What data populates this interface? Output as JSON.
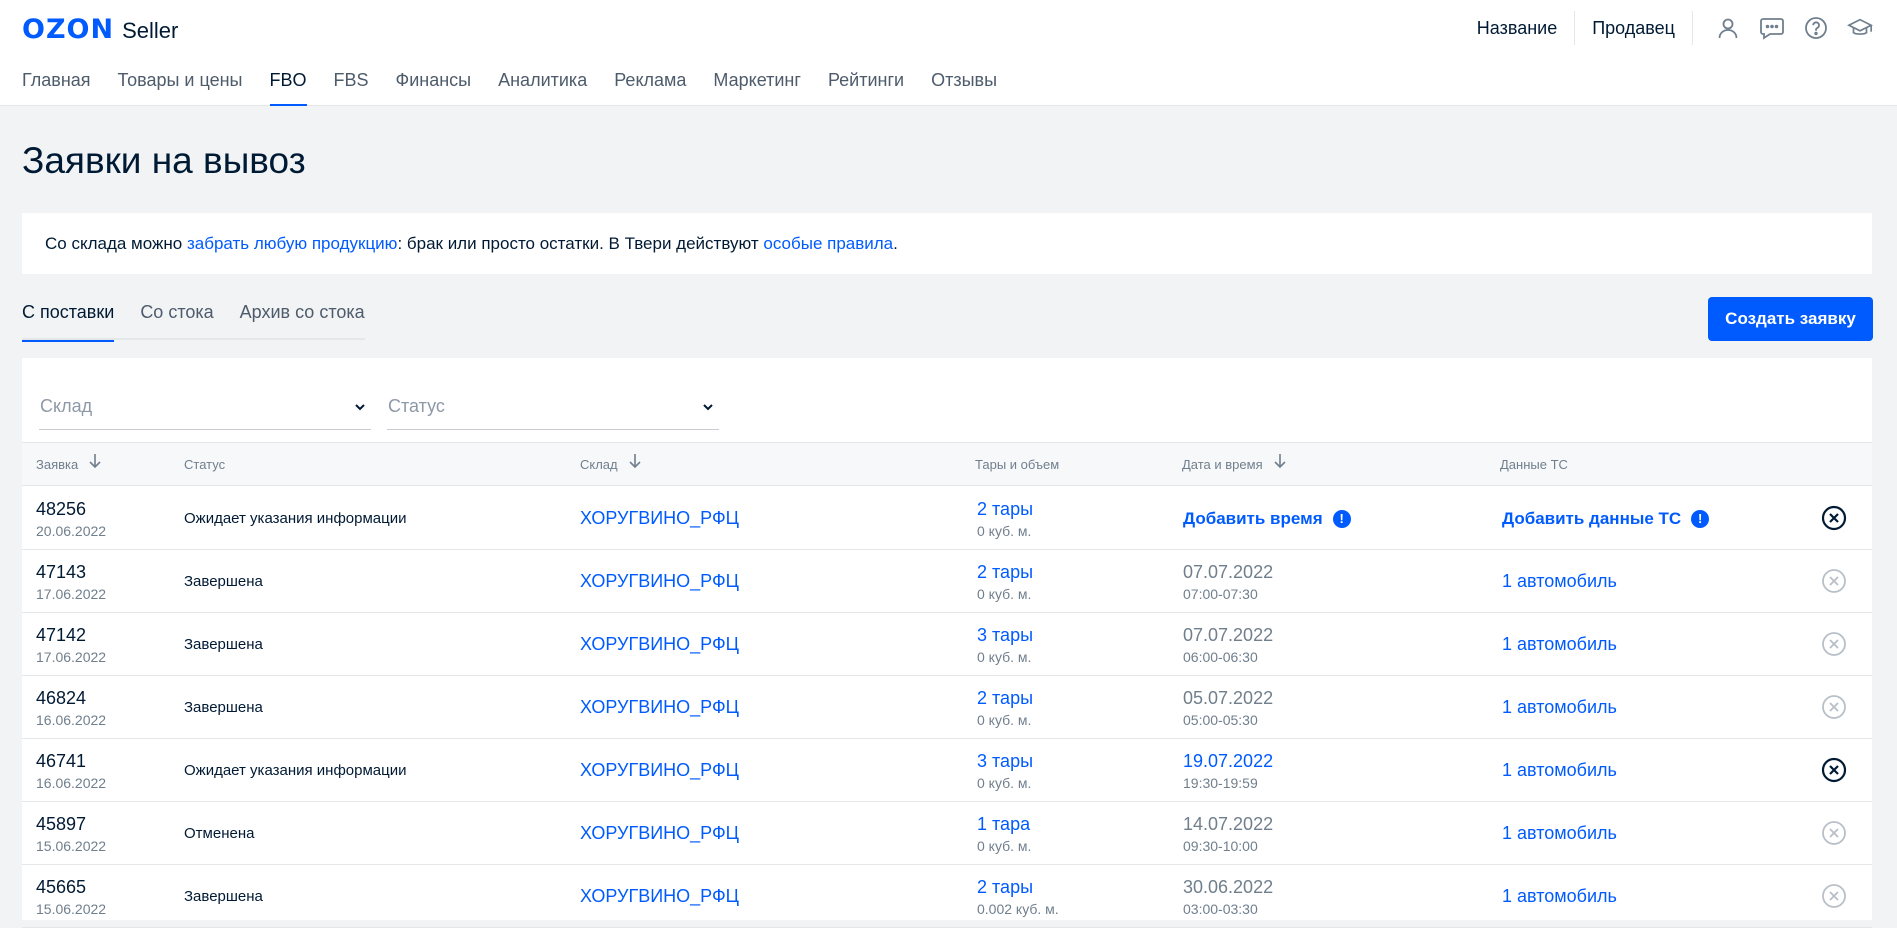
{
  "header": {
    "logo_brand": "OZON",
    "logo_product": "Seller",
    "top_links": [
      "Название",
      "Продавец"
    ],
    "icons": [
      "user-icon",
      "chat-icon",
      "help-icon",
      "education-icon"
    ],
    "nav": [
      "Главная",
      "Товары и цены",
      "FBO",
      "FBS",
      "Финансы",
      "Аналитика",
      "Реклама",
      "Маркетинг",
      "Рейтинги",
      "Отзывы"
    ],
    "nav_active": "FBO"
  },
  "page": {
    "title": "Заявки на вывоз",
    "notice": {
      "text1": "Со склада можно ",
      "link1": "забрать любую продукцию",
      "text2": ": брак или просто остатки. В Твери действуют ",
      "link2": "особые правила",
      "text3": "."
    },
    "tabs": [
      "С поставки",
      "Со стока",
      "Архив со стока"
    ],
    "active_tab": "С поставки",
    "create_button": "Создать заявку"
  },
  "filters": {
    "warehouse_placeholder": "Склад",
    "status_placeholder": "Статус"
  },
  "table": {
    "columns": [
      "Заявка",
      "Статус",
      "Склад",
      "Тары и объем",
      "Дата и время",
      "Данные ТС"
    ],
    "rows": [
      {
        "id": "48256",
        "date": "20.06.2022",
        "status": "Ожидает указания информации",
        "warehouse": "ХОРУГВИНО_РФЦ",
        "tares": "2 тары",
        "volume": "0 куб. м.",
        "time_action": "Добавить время",
        "vehicle_action": "Добавить данные ТС",
        "cancelable": true
      },
      {
        "id": "47143",
        "date": "17.06.2022",
        "status": "Завершена",
        "warehouse": "ХОРУГВИНО_РФЦ",
        "tares": "2 тары",
        "volume": "0 куб. м.",
        "slot_date": "07.07.2022",
        "slot_time": "07:00-07:30",
        "vehicle": "1 автомобиль",
        "cancelable": false
      },
      {
        "id": "47142",
        "date": "17.06.2022",
        "status": "Завершена",
        "warehouse": "ХОРУГВИНО_РФЦ",
        "tares": "3 тары",
        "volume": "0 куб. м.",
        "slot_date": "07.07.2022",
        "slot_time": "06:00-06:30",
        "vehicle": "1 автомобиль",
        "cancelable": false
      },
      {
        "id": "46824",
        "date": "16.06.2022",
        "status": "Завершена",
        "warehouse": "ХОРУГВИНО_РФЦ",
        "tares": "2 тары",
        "volume": "0 куб. м.",
        "slot_date": "05.07.2022",
        "slot_time": "05:00-05:30",
        "vehicle": "1 автомобиль",
        "cancelable": false
      },
      {
        "id": "46741",
        "date": "16.06.2022",
        "status": "Ожидает указания информации",
        "warehouse": "ХОРУГВИНО_РФЦ",
        "tares": "3 тары",
        "volume": "0 куб. м.",
        "slot_date": "19.07.2022",
        "slot_time": "19:30-19:59",
        "slot_date_editable": true,
        "vehicle": "1 автомобиль",
        "cancelable": true
      },
      {
        "id": "45897",
        "date": "15.06.2022",
        "status": "Отменена",
        "warehouse": "ХОРУГВИНО_РФЦ",
        "tares": "1 тара",
        "volume": "0 куб. м.",
        "slot_date": "14.07.2022",
        "slot_time": "09:30-10:00",
        "vehicle": "1 автомобиль",
        "cancelable": false
      },
      {
        "id": "45665",
        "date": "15.06.2022",
        "status": "Завершена",
        "warehouse": "ХОРУГВИНО_РФЦ",
        "tares": "2 тары",
        "volume": "0.002 куб. м.",
        "slot_date": "30.06.2022",
        "slot_time": "03:00-03:30",
        "vehicle": "1 автомобиль",
        "cancelable": false
      }
    ]
  },
  "colors": {
    "accent": "#005bff",
    "text": "#001a34",
    "muted": "#707f8d",
    "background": "#f2f3f5"
  }
}
